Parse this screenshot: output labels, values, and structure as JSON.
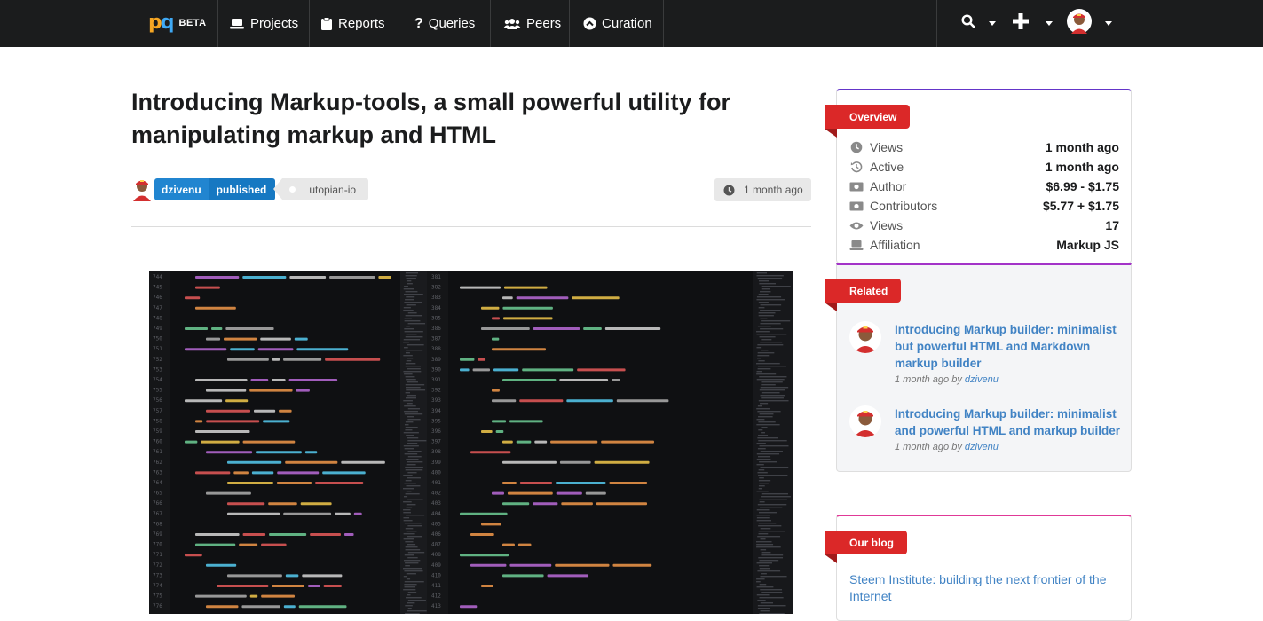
{
  "nav": {
    "logo_text": "pq",
    "beta": "BETA",
    "items": [
      {
        "label": "Projects",
        "icon": "laptop-icon"
      },
      {
        "label": "Reports",
        "icon": "clipboard-icon"
      },
      {
        "label": "Queries",
        "icon": "question-icon"
      },
      {
        "label": "Peers",
        "icon": "users-icon"
      },
      {
        "label": "Curation",
        "icon": "chevron-circle-up-icon"
      }
    ]
  },
  "article": {
    "title": "Introducing Markup-tools, a small powerful utility for manipulating markup and HTML",
    "author": "dzivenu",
    "status": "published",
    "tag": "utopian-io",
    "time": "1 month ago"
  },
  "overview": {
    "ribbon": "Overview",
    "rows": [
      {
        "label": "Views",
        "value": "1 month ago",
        "icon": "clock-icon"
      },
      {
        "label": "Active",
        "value": "1 month ago",
        "icon": "history-icon"
      },
      {
        "label": "Author",
        "value": "$6.99 - $1.75",
        "icon": "money-icon"
      },
      {
        "label": "Contributors",
        "value": "$5.77 + $1.75",
        "icon": "money-icon"
      },
      {
        "label": "Views",
        "value": "17",
        "icon": "eye-icon"
      },
      {
        "label": "Affiliation",
        "value": "Markup JS",
        "icon": "laptop-icon"
      }
    ]
  },
  "related": {
    "ribbon": "Related",
    "items": [
      {
        "title": "Introducing Markup builder: minimalist but powerful HTML and Markdown markup builder",
        "time": "1 month ago by",
        "author": "dzivenu"
      },
      {
        "title": "Introducing Markup builder: minimalist and powerful HTML and markup builder",
        "time": "1 month ago by",
        "author": "dzivenu"
      }
    ]
  },
  "blog": {
    "ribbon": "Our blog",
    "link": "Steem Institute: building the next frontier of the Internet"
  },
  "colors": {
    "navbar": "#1b1c1d",
    "primary_blue": "#2185d0",
    "ribbon_red": "#db2828",
    "link_blue": "#4183c4"
  }
}
